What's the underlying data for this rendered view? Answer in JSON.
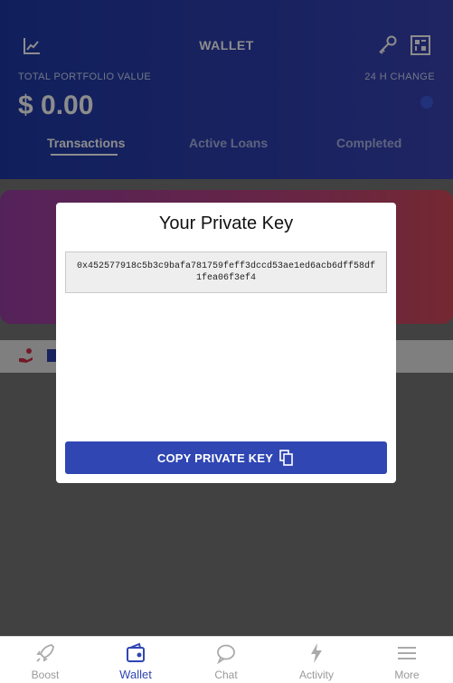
{
  "header": {
    "title": "WALLET",
    "portfolio_label": "TOTAL PORTFOLIO VALUE",
    "portfolio_value": "$ 0.00",
    "change_label": "24 H CHANGE",
    "tabs": [
      {
        "label": "Transactions",
        "active": true
      },
      {
        "label": "Active Loans",
        "active": false
      },
      {
        "label": "Completed",
        "active": false
      }
    ]
  },
  "modal": {
    "title": "Your Private Key",
    "private_key": "0x452577918c5b3c9bafa781759feff3dccd53ae1ed6acb6dff58df1fea06f3ef4",
    "copy_button_label": "COPY PRIVATE KEY"
  },
  "bottom_nav": {
    "items": [
      {
        "label": "Boost",
        "icon": "rocket-icon"
      },
      {
        "label": "Wallet",
        "icon": "wallet-icon",
        "active": true
      },
      {
        "label": "Chat",
        "icon": "chat-icon"
      },
      {
        "label": "Activity",
        "icon": "activity-icon"
      },
      {
        "label": "More",
        "icon": "menu-icon"
      }
    ]
  },
  "colors": {
    "header_blue": "#1e3aa8",
    "accent_button": "#2f46b3",
    "promo_gradient_start": "#9a3fa6",
    "promo_gradient_end": "#d34a5b"
  }
}
